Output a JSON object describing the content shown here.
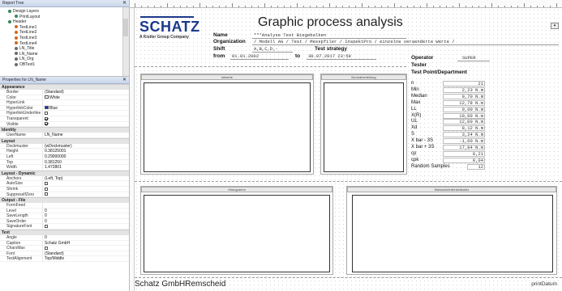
{
  "report_tree": {
    "title": "Report Tree",
    "close": "✕",
    "items": [
      "Design Layers",
      "PrintLayout",
      "Header",
      "TextLine1",
      "TextLine2",
      "TextLine3",
      "TextLine4",
      "LN_Title",
      "LN_Name",
      "LN_Org",
      "OBText1"
    ]
  },
  "properties": {
    "title": "Properties for LN_Name",
    "close": "✕",
    "sections": [
      {
        "name": "Appearance",
        "rows": [
          {
            "n": "Border",
            "v": "(Standard)"
          },
          {
            "n": "Color",
            "v": "White",
            "swatch": "#ffffff"
          },
          {
            "n": "HyperLink",
            "v": ""
          },
          {
            "n": "HyperlinkColor",
            "v": "Blue",
            "swatch": "#1a2fd0"
          },
          {
            "n": "HyperlinkUnderline",
            "v": "",
            "check": false
          },
          {
            "n": "Transparent",
            "v": "",
            "check": true
          },
          {
            "n": "Visible",
            "v": "",
            "check": true
          }
        ]
      },
      {
        "name": "Identity",
        "rows": [
          {
            "n": "UserName",
            "v": "LN_Name"
          }
        ]
      },
      {
        "name": "Layout",
        "rows": [
          {
            "n": "Dockmuster",
            "v": "(wDockmuster)"
          },
          {
            "n": "Height",
            "v": "0.38125001"
          },
          {
            "n": "Left",
            "v": "0.29000000"
          },
          {
            "n": "Top",
            "v": "0.381250"
          },
          {
            "n": "Width",
            "v": "1.472801"
          }
        ]
      },
      {
        "name": "Layout - Dynamic",
        "rows": [
          {
            "n": "Anchors",
            "v": "(Left, Top)"
          },
          {
            "n": "AutoSize",
            "v": "",
            "check": false
          },
          {
            "n": "Shrink",
            "v": "",
            "check": false
          },
          {
            "n": "SuppressIfZero",
            "v": "",
            "check": false
          }
        ]
      },
      {
        "name": "Output - File",
        "rows": [
          {
            "n": "FormFeed",
            "v": ""
          },
          {
            "n": "Level",
            "v": "0"
          },
          {
            "n": "SaveLength",
            "v": "0"
          },
          {
            "n": "SaveOrder",
            "v": "0"
          },
          {
            "n": "SignatureFont",
            "v": "",
            "check": false
          }
        ]
      },
      {
        "name": "Text",
        "rows": [
          {
            "n": "Angle",
            "v": "0"
          },
          {
            "n": "Caption",
            "v": "Schatz GmbH"
          },
          {
            "n": "CharsMax",
            "v": "",
            "check": false
          },
          {
            "n": "Font",
            "v": "(Standard)"
          },
          {
            "n": "TextAlignment",
            "v": "Top/Middle"
          }
        ]
      }
    ]
  },
  "report": {
    "logo": "SCHATZ",
    "logo_sub": "A Kistler Group Company",
    "title": "Graphic process analysis",
    "labels": {
      "name": "Name",
      "organization": "Organization",
      "shift": "Shift",
      "from": "from",
      "to": "to",
      "test_strategy": "Test strategy",
      "operator": "Operator",
      "tester": "Tester",
      "test_point": "Test Point/Department"
    },
    "values": {
      "name": "***Analyse          Test Biegebalken",
      "organization": "/ Modell AG / Test / Messpfiler / InspektPro / einzelne veraenderte Werte /",
      "shift": "A,B,C,D,-",
      "from": "01.01.2002",
      "to": "30.07.2017 23:59",
      "operator": "SUPER"
    },
    "boxes": {
      "values_title": "Istwerte",
      "histogram_title": "Normalverteilung",
      "hist2_title": "Histogramm",
      "trend_title": "Wahrscheinlichkeitsnetz"
    },
    "stats": [
      {
        "label": "n",
        "value": "21"
      },
      {
        "label": "Min",
        "value": "2,23 N.m"
      },
      {
        "label": "Median",
        "value": "9,70 N.m"
      },
      {
        "label": "Max",
        "value": "12,78 N.m"
      },
      {
        "label": "LL",
        "value": "0,00 N.m"
      },
      {
        "label": "X(R)",
        "value": "10,00 N.m"
      },
      {
        "label": "UL",
        "value": "12,00 N.m"
      },
      {
        "label": "Xd",
        "value": "8,12 N.m"
      },
      {
        "label": "S",
        "value": "3,24 N.m"
      },
      {
        "label": "X bar - 3S",
        "value": "-1,60 N.m"
      },
      {
        "label": "X bar + 3S",
        "value": "17,84 N.m"
      },
      {
        "label": "cp",
        "value": "0,21"
      },
      {
        "label": "cpk",
        "value": "0,04"
      },
      {
        "label": "Random Samples",
        "value": "12"
      }
    ],
    "footer_left": "Schatz GmbHRemscheid",
    "footer_right": "printDatum"
  },
  "colors": {
    "brand": "#1c3a8a",
    "panel_title": "#c9d6ea"
  }
}
